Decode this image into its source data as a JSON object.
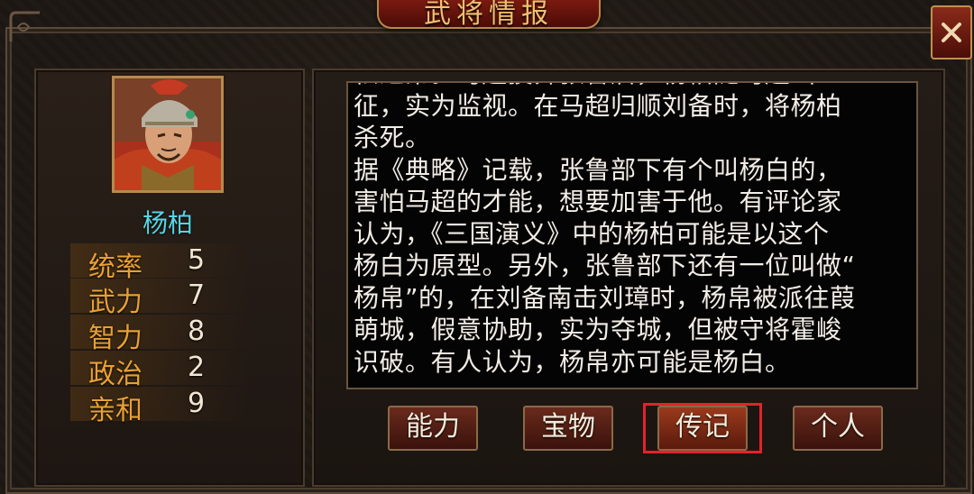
{
  "window": {
    "title": "武将情报"
  },
  "general": {
    "name": "杨柏",
    "stats": [
      {
        "label": "统率",
        "value": "5"
      },
      {
        "label": "武力",
        "value": "7"
      },
      {
        "label": "智力",
        "value": "8"
      },
      {
        "label": "政治",
        "value": "2"
      },
      {
        "label": "亲和",
        "value": "9"
      }
    ]
  },
  "biography": {
    "text": "松之弟。马超投奔张鲁后，杨柏随马超出\n征，实为监视。在马超归顺刘备时，将杨柏\n杀死。\n据《典略》记载，张鲁部下有个叫杨白的，\n害怕马超的才能，想要加害于他。有评论家\n认为，《三国演义》中的杨柏可能是以这个\n杨白为原型。另外，张鲁部下还有一位叫做“\n杨帛”的，在刘备南击刘璋时，杨帛被派往葭\n萌城，假意协助，实为夺城，但被守将霍峻\n识破。有人认为，杨帛亦可能是杨白。"
  },
  "tabs": [
    {
      "label": "能力",
      "active": false
    },
    {
      "label": "宝物",
      "active": false
    },
    {
      "label": "传记",
      "active": true
    },
    {
      "label": "个人",
      "active": false
    }
  ],
  "icons": {
    "close": "close-icon",
    "portrait": "general-portrait"
  },
  "colors": {
    "stat_label": "#e8a034",
    "name": "#58d4e4",
    "highlight": "#e0242a"
  }
}
